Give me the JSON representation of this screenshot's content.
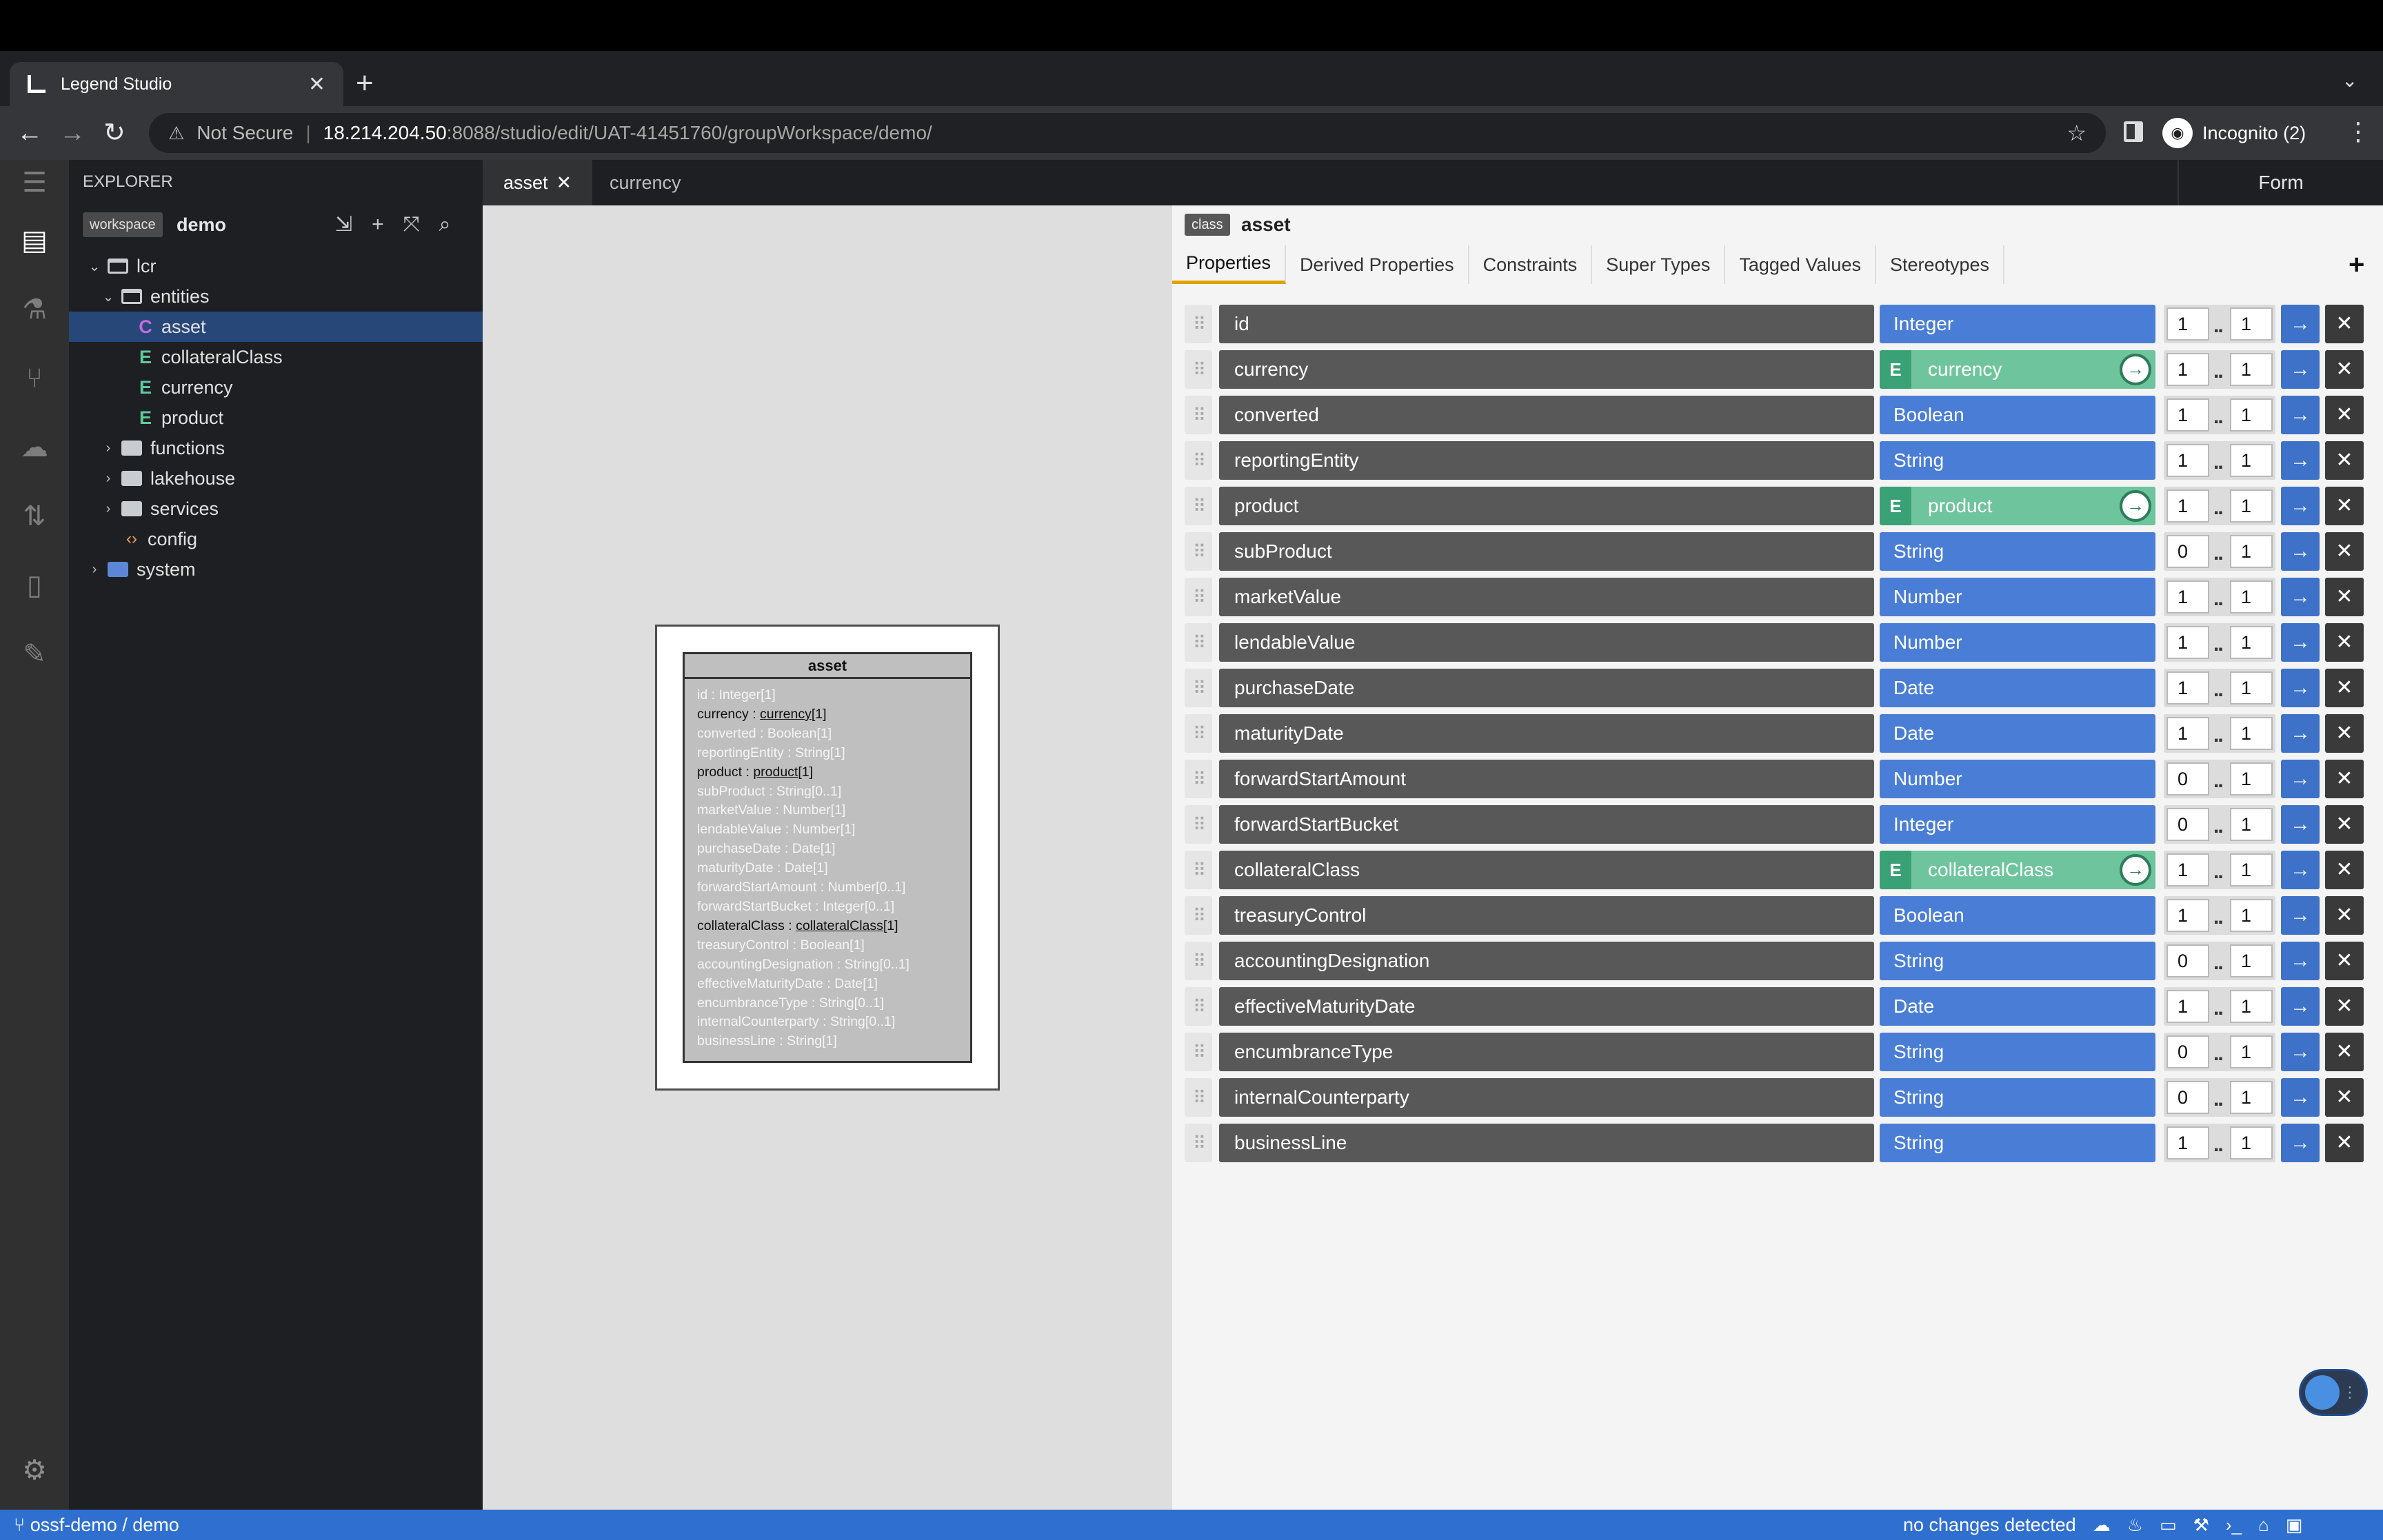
{
  "browser": {
    "tab_title": "Legend Studio",
    "new_tab": "+",
    "not_secure": "Not Secure",
    "url_host": "18.214.204.50",
    "url_path": ":8088/studio/edit/UAT-41451760/groupWorkspace/demo/",
    "profile": "Incognito (2)"
  },
  "explorer": {
    "title": "EXPLORER",
    "workspace_badge": "workspace",
    "workspace_name": "demo",
    "tree": [
      {
        "label": "lcr",
        "kind": "folder-open",
        "depth": 0,
        "chevron": "⌄"
      },
      {
        "label": "entities",
        "kind": "folder-open",
        "depth": 1,
        "chevron": "⌄"
      },
      {
        "label": "asset",
        "kind": "class",
        "letter": "C",
        "depth": 2,
        "selected": true
      },
      {
        "label": "collateralClass",
        "kind": "enum",
        "letter": "E",
        "depth": 2
      },
      {
        "label": "currency",
        "kind": "enum",
        "letter": "E",
        "depth": 2
      },
      {
        "label": "product",
        "kind": "enum",
        "letter": "E",
        "depth": 2
      },
      {
        "label": "functions",
        "kind": "folder",
        "depth": 1,
        "chevron": "›"
      },
      {
        "label": "lakehouse",
        "kind": "folder",
        "depth": 1,
        "chevron": "›"
      },
      {
        "label": "services",
        "kind": "folder",
        "depth": 1,
        "chevron": "›"
      },
      {
        "label": "config",
        "kind": "config",
        "depth": 1
      },
      {
        "label": "system",
        "kind": "folder-blue",
        "depth": 0,
        "chevron": "›"
      }
    ]
  },
  "editor_tabs": [
    {
      "label": "asset",
      "active": true,
      "close": "✕"
    },
    {
      "label": "currency",
      "active": false
    }
  ],
  "form_mode_tab": "Form",
  "diagram": {
    "class_name": "asset",
    "lines": [
      {
        "name": "id",
        "type": "Integer",
        "mult": "[1]",
        "ref": false
      },
      {
        "name": "currency",
        "type": "currency",
        "mult": "[1]",
        "ref": true
      },
      {
        "name": "converted",
        "type": "Boolean",
        "mult": "[1]",
        "ref": false
      },
      {
        "name": "reportingEntity",
        "type": "String",
        "mult": "[1]",
        "ref": false
      },
      {
        "name": "product",
        "type": "product",
        "mult": "[1]",
        "ref": true
      },
      {
        "name": "subProduct",
        "type": "String",
        "mult": "[0..1]",
        "ref": false
      },
      {
        "name": "marketValue",
        "type": "Number",
        "mult": "[1]",
        "ref": false
      },
      {
        "name": "lendableValue",
        "type": "Number",
        "mult": "[1]",
        "ref": false
      },
      {
        "name": "purchaseDate",
        "type": "Date",
        "mult": "[1]",
        "ref": false
      },
      {
        "name": "maturityDate",
        "type": "Date",
        "mult": "[1]",
        "ref": false
      },
      {
        "name": "forwardStartAmount",
        "type": "Number",
        "mult": "[0..1]",
        "ref": false
      },
      {
        "name": "forwardStartBucket",
        "type": "Integer",
        "mult": "[0..1]",
        "ref": false
      },
      {
        "name": "collateralClass",
        "type": "collateralClass",
        "mult": "[1]",
        "ref": true
      },
      {
        "name": "treasuryControl",
        "type": "Boolean",
        "mult": "[1]",
        "ref": false
      },
      {
        "name": "accountingDesignation",
        "type": "String",
        "mult": "[0..1]",
        "ref": false
      },
      {
        "name": "effectiveMaturityDate",
        "type": "Date",
        "mult": "[1]",
        "ref": false
      },
      {
        "name": "encumbranceType",
        "type": "String",
        "mult": "[0..1]",
        "ref": false
      },
      {
        "name": "internalCounterparty",
        "type": "String",
        "mult": "[0..1]",
        "ref": false
      },
      {
        "name": "businessLine",
        "type": "String",
        "mult": "[1]",
        "ref": false
      }
    ]
  },
  "form": {
    "class_badge": "class",
    "class_name": "asset",
    "tabs": [
      "Properties",
      "Derived Properties",
      "Constraints",
      "Super Types",
      "Tagged Values",
      "Stereotypes"
    ],
    "add": "+",
    "mult_sep": "..",
    "properties": [
      {
        "name": "id",
        "type": "Integer",
        "enum": false,
        "lower": "1",
        "upper": "1"
      },
      {
        "name": "currency",
        "type": "currency",
        "enum": true,
        "lower": "1",
        "upper": "1"
      },
      {
        "name": "converted",
        "type": "Boolean",
        "enum": false,
        "lower": "1",
        "upper": "1"
      },
      {
        "name": "reportingEntity",
        "type": "String",
        "enum": false,
        "lower": "1",
        "upper": "1"
      },
      {
        "name": "product",
        "type": "product",
        "enum": true,
        "lower": "1",
        "upper": "1"
      },
      {
        "name": "subProduct",
        "type": "String",
        "enum": false,
        "lower": "0",
        "upper": "1"
      },
      {
        "name": "marketValue",
        "type": "Number",
        "enum": false,
        "lower": "1",
        "upper": "1"
      },
      {
        "name": "lendableValue",
        "type": "Number",
        "enum": false,
        "lower": "1",
        "upper": "1"
      },
      {
        "name": "purchaseDate",
        "type": "Date",
        "enum": false,
        "lower": "1",
        "upper": "1"
      },
      {
        "name": "maturityDate",
        "type": "Date",
        "enum": false,
        "lower": "1",
        "upper": "1"
      },
      {
        "name": "forwardStartAmount",
        "type": "Number",
        "enum": false,
        "lower": "0",
        "upper": "1"
      },
      {
        "name": "forwardStartBucket",
        "type": "Integer",
        "enum": false,
        "lower": "0",
        "upper": "1"
      },
      {
        "name": "collateralClass",
        "type": "collateralClass",
        "enum": true,
        "lower": "1",
        "upper": "1"
      },
      {
        "name": "treasuryControl",
        "type": "Boolean",
        "enum": false,
        "lower": "1",
        "upper": "1"
      },
      {
        "name": "accountingDesignation",
        "type": "String",
        "enum": false,
        "lower": "0",
        "upper": "1"
      },
      {
        "name": "effectiveMaturityDate",
        "type": "Date",
        "enum": false,
        "lower": "1",
        "upper": "1"
      },
      {
        "name": "encumbranceType",
        "type": "String",
        "enum": false,
        "lower": "0",
        "upper": "1"
      },
      {
        "name": "internalCounterparty",
        "type": "String",
        "enum": false,
        "lower": "0",
        "upper": "1"
      },
      {
        "name": "businessLine",
        "type": "String",
        "enum": false,
        "lower": "1",
        "upper": "1"
      }
    ]
  },
  "statusbar": {
    "branch": "ossf-demo / demo",
    "changes": "no changes detected"
  },
  "colors": {
    "primitive_type": "#4a7ed6",
    "enum_type": "#6ec59d",
    "status_bar": "#2f6fd0",
    "selection": "#264778"
  }
}
